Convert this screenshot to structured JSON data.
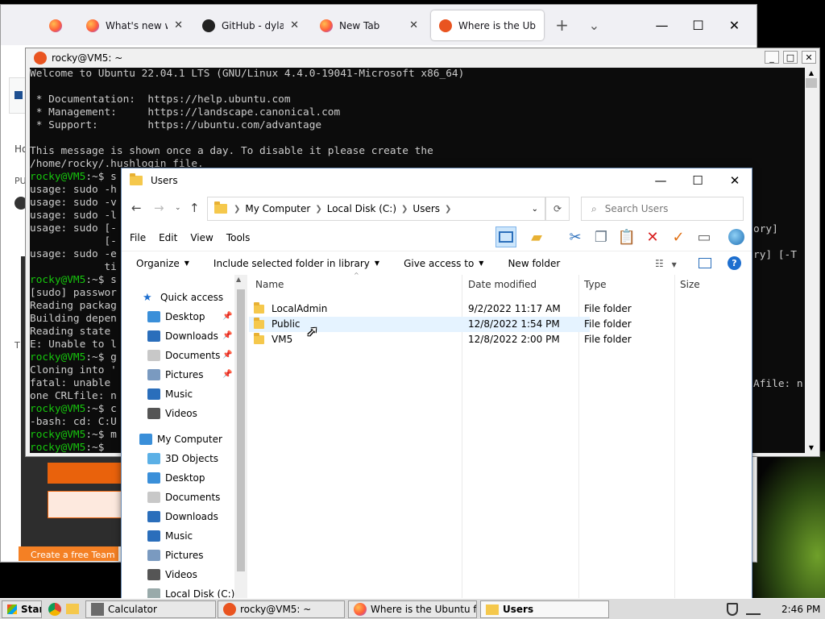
{
  "browser": {
    "tabs": [
      {
        "label": "",
        "icon": "firefox-icon"
      },
      {
        "label": "What's new with",
        "icon": "firefox-icon"
      },
      {
        "label": "GitHub - dylanar",
        "icon": "github-icon"
      },
      {
        "label": "New Tab",
        "icon": "firefox-icon"
      },
      {
        "label": "Where is the Ubu",
        "icon": "askubuntu-icon"
      }
    ],
    "tab_close": "✕",
    "new_tab": "+",
    "list_tabs": "⌄",
    "minimize": "—",
    "maximize": "☐",
    "close": "✕"
  },
  "page_fragments": {
    "ho": "Ho",
    "pu": "PU",
    "t": "T",
    "create_team": "Create a free Team"
  },
  "terminal": {
    "title": "rocky@VM5: ~",
    "lines": [
      {
        "p": "",
        "t": "Welcome to Ubuntu 22.04.1 LTS (GNU/Linux 4.4.0-19041-Microsoft x86_64)"
      },
      {
        "p": "",
        "t": ""
      },
      {
        "p": "",
        "t": " * Documentation:  https://help.ubuntu.com"
      },
      {
        "p": "",
        "t": " * Management:     https://landscape.canonical.com"
      },
      {
        "p": "",
        "t": " * Support:        https://ubuntu.com/advantage"
      },
      {
        "p": "",
        "t": ""
      },
      {
        "p": "",
        "t": "This message is shown once a day. To disable it please create the"
      },
      {
        "p": "",
        "t": "/home/rocky/.hushlogin file."
      },
      {
        "p": "rocky@VM5",
        "t": ":~$ s"
      },
      {
        "p": "",
        "t": "usage: sudo -h"
      },
      {
        "p": "",
        "t": "usage: sudo -v"
      },
      {
        "p": "",
        "t": "usage: sudo -l"
      },
      {
        "p": "",
        "t": "usage: sudo [-"
      },
      {
        "p": "",
        "t": "            [-"
      },
      {
        "p": "",
        "t": "usage: sudo -e"
      },
      {
        "p": "",
        "t": "            ti"
      },
      {
        "p": "rocky@VM5",
        "t": ":~$ s"
      },
      {
        "p": "",
        "t": "[sudo] passwor"
      },
      {
        "p": "",
        "t": "Reading packag"
      },
      {
        "p": "",
        "t": "Building depen"
      },
      {
        "p": "",
        "t": "Reading state"
      },
      {
        "p": "",
        "t": "E: Unable to l"
      },
      {
        "p": "rocky@VM5",
        "t": ":~$ g"
      },
      {
        "p": "",
        "t": "Cloning into '"
      },
      {
        "p": "",
        "t": "fatal: unable"
      },
      {
        "p": "",
        "t": "one CRLfile: n"
      },
      {
        "p": "rocky@VM5",
        "t": ":~$ c"
      },
      {
        "p": "",
        "t": "-bash: cd: C:U"
      },
      {
        "p": "rocky@VM5",
        "t": ":~$ m"
      },
      {
        "p": "rocky@VM5",
        "t": ":~$"
      }
    ],
    "right_fragments": [
      {
        "t": "ory]"
      },
      {
        "t": "ry] [-T"
      },
      {
        "t": "Afile: n"
      }
    ]
  },
  "explorer": {
    "title": "Users",
    "breadcrumb": [
      "My Computer",
      "Local Disk (C:)",
      "Users"
    ],
    "search_placeholder": "Search Users",
    "menu": [
      "File",
      "Edit",
      "View",
      "Tools"
    ],
    "commands": {
      "organize": "Organize",
      "include": "Include selected folder in library",
      "share": "Give access to",
      "new_folder": "New folder"
    },
    "nav": {
      "quick_access": "Quick access",
      "quick": [
        {
          "label": "Desktop",
          "icon": "desktop-icon",
          "pinned": true
        },
        {
          "label": "Downloads",
          "icon": "downloads-icon",
          "pinned": true
        },
        {
          "label": "Documents",
          "icon": "documents-icon",
          "pinned": true
        },
        {
          "label": "Pictures",
          "icon": "pictures-icon",
          "pinned": true
        },
        {
          "label": "Music",
          "icon": "music-icon",
          "pinned": false
        },
        {
          "label": "Videos",
          "icon": "videos-icon",
          "pinned": false
        }
      ],
      "my_computer": "My Computer",
      "computer": [
        {
          "label": "3D Objects",
          "icon": "3d-objects-icon"
        },
        {
          "label": "Desktop",
          "icon": "desktop-icon"
        },
        {
          "label": "Documents",
          "icon": "documents-icon"
        },
        {
          "label": "Downloads",
          "icon": "downloads-icon"
        },
        {
          "label": "Music",
          "icon": "music-icon"
        },
        {
          "label": "Pictures",
          "icon": "pictures-icon"
        },
        {
          "label": "Videos",
          "icon": "videos-icon"
        },
        {
          "label": "Local Disk (C:)",
          "icon": "drive-icon"
        }
      ]
    },
    "columns": [
      "Name",
      "Date modified",
      "Type",
      "Size"
    ],
    "rows": [
      {
        "name": "LocalAdmin",
        "date": "9/2/2022 11:17 AM",
        "type": "File folder",
        "size": ""
      },
      {
        "name": "Public",
        "date": "12/8/2022 1:54 PM",
        "type": "File folder",
        "size": ""
      },
      {
        "name": "VM5",
        "date": "12/8/2022 2:00 PM",
        "type": "File folder",
        "size": ""
      }
    ],
    "hovered_row": 1
  },
  "taskbar": {
    "start": "Start",
    "items": [
      {
        "label": "Calculator",
        "icon": "calculator-icon"
      },
      {
        "label": "rocky@VM5: ~",
        "icon": "ubuntu-icon"
      },
      {
        "label": "Where is the Ubuntu fil...",
        "icon": "firefox-icon"
      },
      {
        "label": "Users",
        "icon": "folder-icon",
        "active": true
      }
    ],
    "clock": "2:46 PM"
  },
  "colors": {
    "terminal_prompt": "#16c60c",
    "ubuntu_orange": "#e95420",
    "accent_blue": "#0078d7"
  }
}
